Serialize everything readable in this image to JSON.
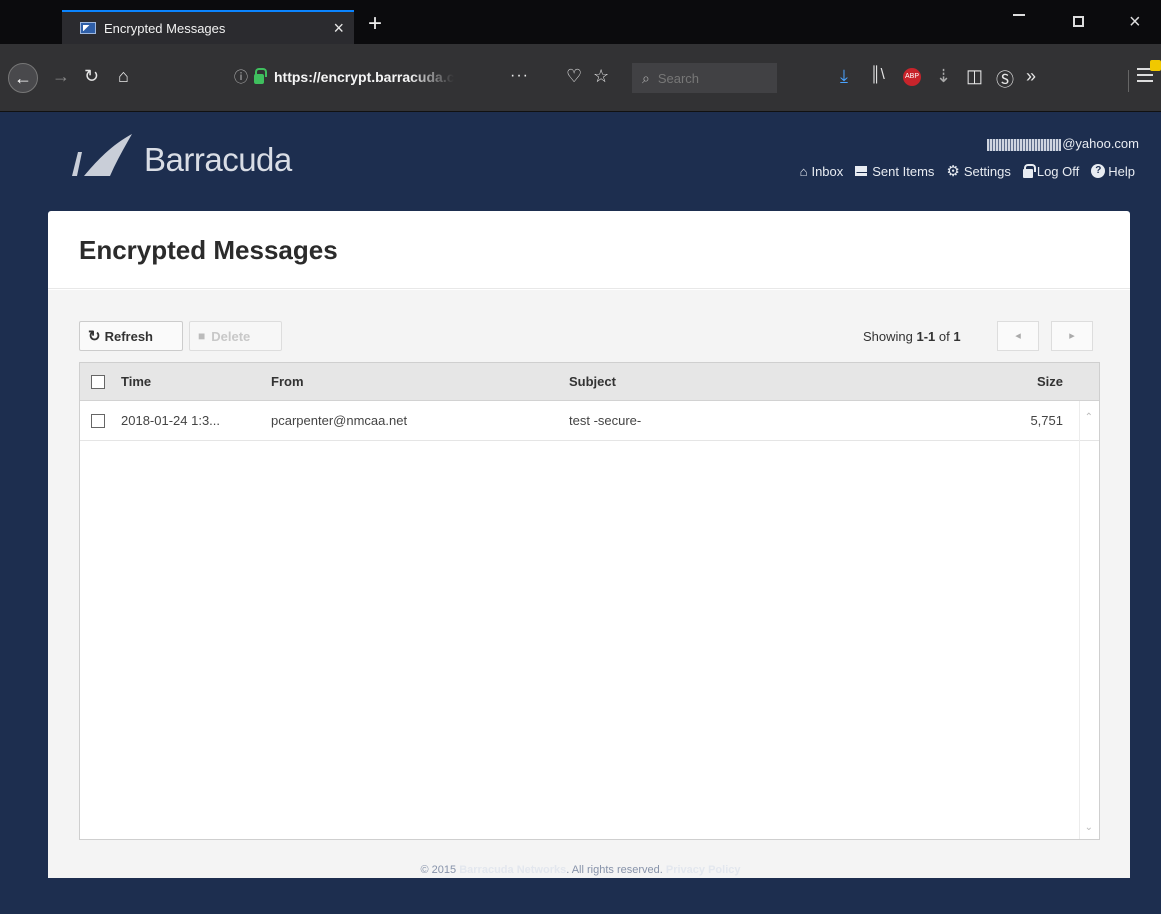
{
  "browser": {
    "tab_title": "Encrypted Messages",
    "tab_close": "×",
    "new_tab": "+",
    "url": "https://encrypt.barracuda.com",
    "url_more": "···",
    "search_placeholder": "Search",
    "window_close": "×"
  },
  "header": {
    "logo_text": "Barracuda",
    "user_email_visible": "@yahoo.com",
    "nav": {
      "inbox": "Inbox",
      "sent_items": "Sent Items",
      "settings": "Settings",
      "log_off": "Log Off",
      "help": "Help"
    }
  },
  "main": {
    "title": "Encrypted Messages",
    "refresh_label": "Refresh",
    "delete_label": "Delete",
    "showing_prefix": "Showing ",
    "showing_range": "1-1",
    "showing_of": " of ",
    "showing_total": "1",
    "pager_prev": "◂",
    "pager_next": "▸",
    "columns": {
      "time": "Time",
      "from": "From",
      "subject": "Subject",
      "size": "Size"
    },
    "rows": [
      {
        "time": "2018-01-24 1:3...",
        "from": "pcarpenter@nmcaa.net",
        "subject": "test -secure-",
        "size": "5,751"
      }
    ]
  },
  "footer": {
    "copyright_prefix": "© 2015 ",
    "company": "Barracuda Networks",
    "rights": ". All rights reserved. ",
    "privacy": "Privacy Policy"
  },
  "colors": {
    "page_background": "#1d2e4f",
    "browser_chrome": "#323234",
    "card_background": "#ffffff",
    "grid_header": "#e6e6e6"
  }
}
